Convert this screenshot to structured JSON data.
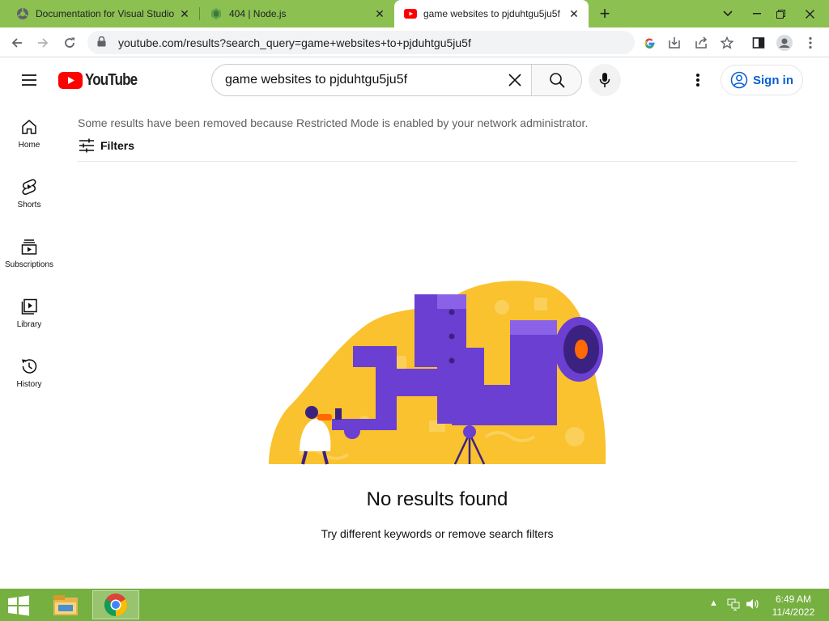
{
  "browser": {
    "tabs": [
      {
        "title": "Documentation for Visual Studio",
        "active": false
      },
      {
        "title": "404 | Node.js",
        "active": false
      },
      {
        "title": "game websites to pjduhtgu5ju5f",
        "active": true
      }
    ],
    "url": "youtube.com/results?search_query=game+websites+to+pjduhtgu5ju5f"
  },
  "youtube": {
    "logo_text": "YouTube",
    "search_value": "game websites to pjduhtgu5ju5f",
    "sign_in_label": "Sign in",
    "sidebar": [
      {
        "label": "Home",
        "icon": "home-icon"
      },
      {
        "label": "Shorts",
        "icon": "shorts-icon"
      },
      {
        "label": "Subscriptions",
        "icon": "subscriptions-icon"
      },
      {
        "label": "Library",
        "icon": "library-icon"
      },
      {
        "label": "History",
        "icon": "history-icon"
      }
    ],
    "notice": "Some results have been removed because Restricted Mode is enabled by your network administrator.",
    "filters_label": "Filters",
    "no_results_title": "No results found",
    "no_results_subtitle": "Try different keywords or remove search filters"
  },
  "taskbar": {
    "time": "6:49 AM",
    "date": "11/4/2022"
  },
  "colors": {
    "tabstrip": "#8cc152",
    "taskbar": "#76b041",
    "youtube_red": "#ff0000",
    "link_blue": "#065fd4",
    "illus_yellow": "#f9c22e",
    "illus_purple": "#6b3fd1"
  }
}
